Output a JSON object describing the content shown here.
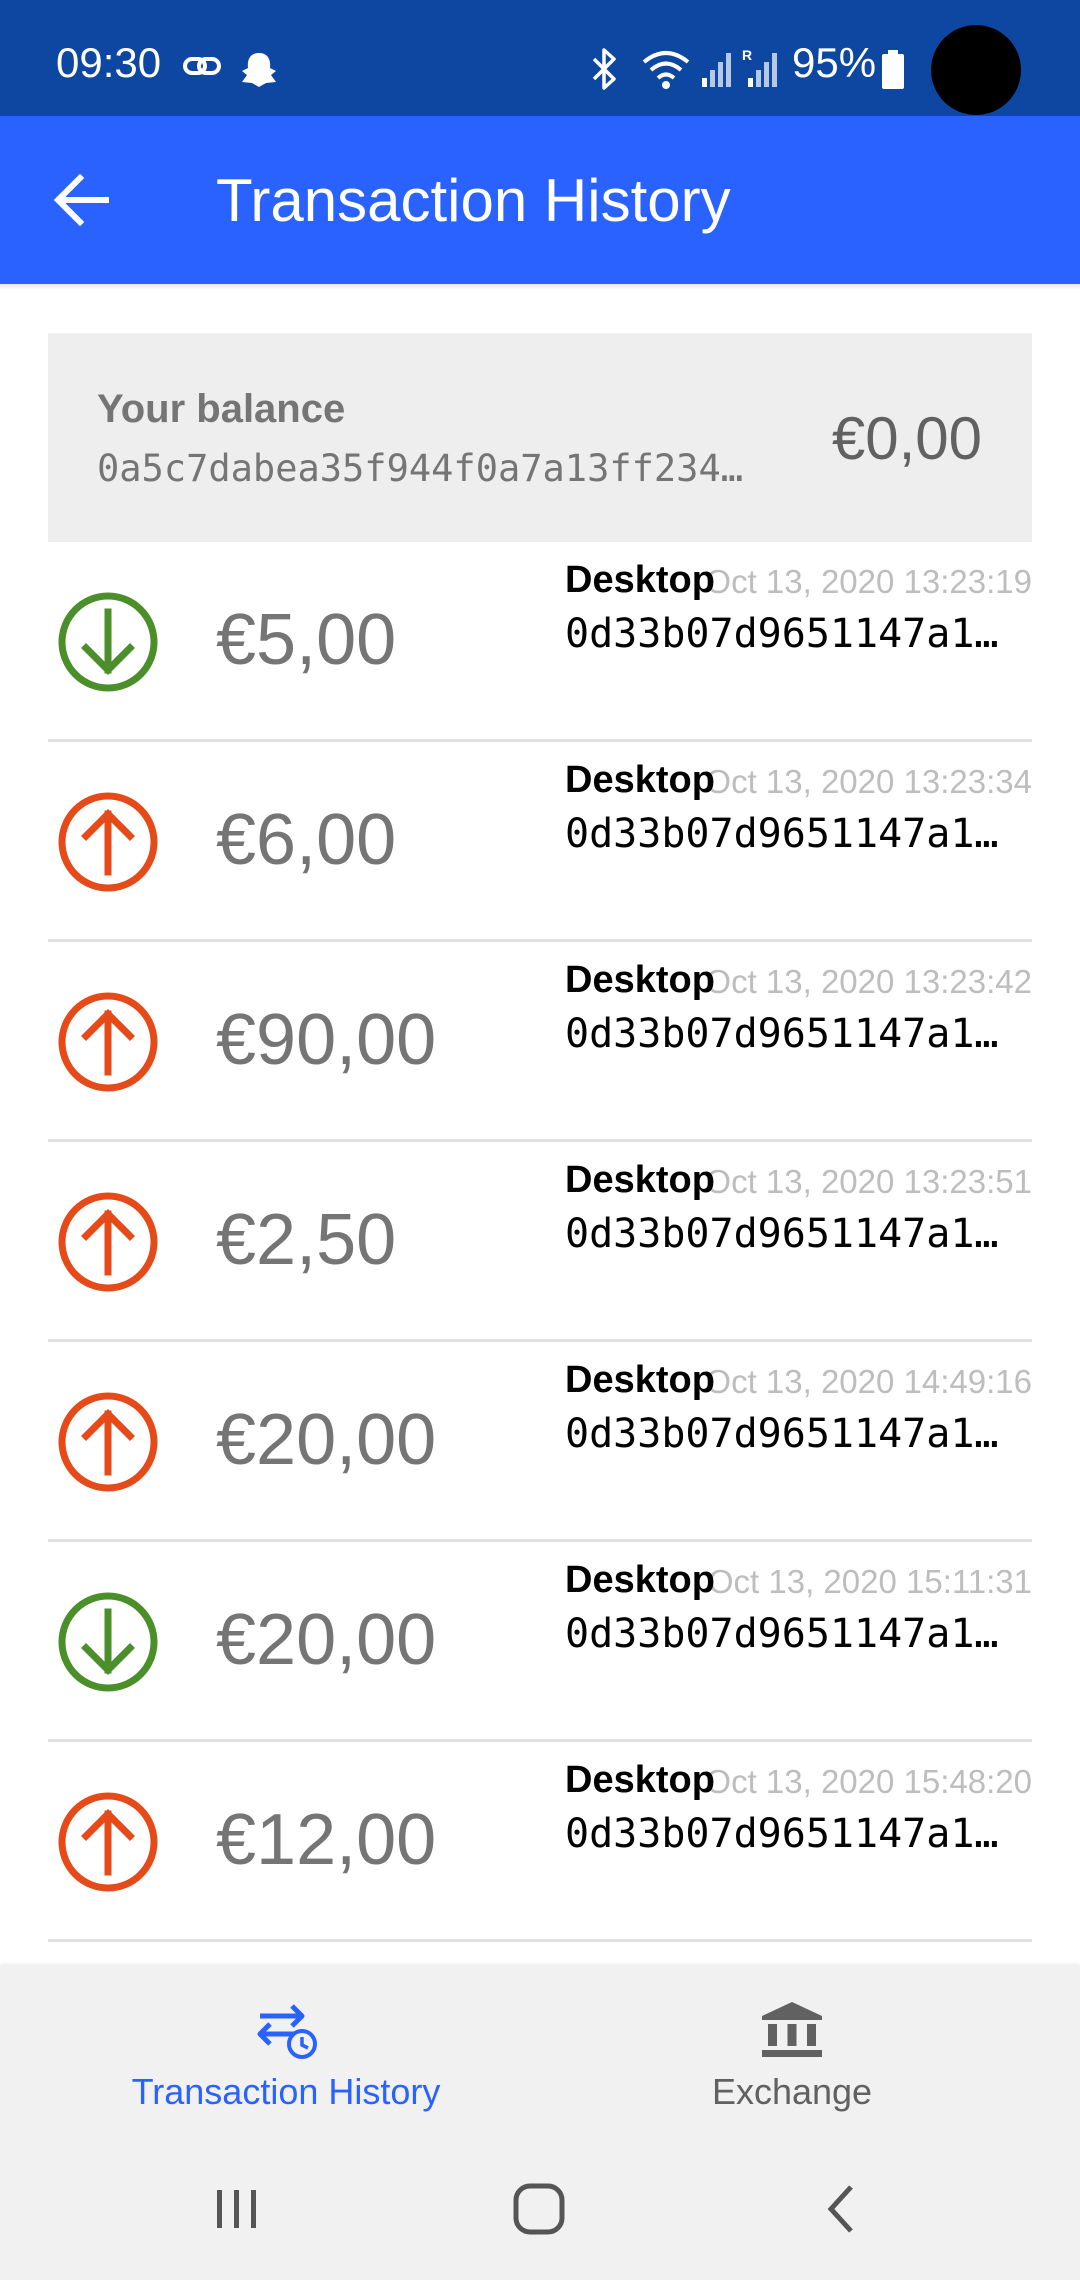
{
  "status_bar": {
    "time": "09:30",
    "battery": "95%",
    "icons": [
      "link-icon",
      "snapchat-icon",
      "bluetooth-icon",
      "wifi-icon",
      "signal-icon",
      "roaming-signal-icon",
      "battery-icon"
    ]
  },
  "header": {
    "title": "Transaction History",
    "back_icon": "arrow-back-icon"
  },
  "balance": {
    "label": "Your balance",
    "address": "0a5c7dabea35f944f0a7a13ff234…",
    "amount": "€0,00"
  },
  "transactions": [
    {
      "direction": "incoming",
      "amount": "€5,00",
      "peer": "Desktop",
      "date": "Oct 13, 2020 13:23:19",
      "address": "0d33b07d9651147a1…"
    },
    {
      "direction": "outgoing",
      "amount": "€6,00",
      "peer": "Desktop",
      "date": "Oct 13, 2020 13:23:34",
      "address": "0d33b07d9651147a1…"
    },
    {
      "direction": "outgoing",
      "amount": "€90,00",
      "peer": "Desktop",
      "date": "Oct 13, 2020 13:23:42",
      "address": "0d33b07d9651147a1…"
    },
    {
      "direction": "outgoing",
      "amount": "€2,50",
      "peer": "Desktop",
      "date": "Oct 13, 2020 13:23:51",
      "address": "0d33b07d9651147a1…"
    },
    {
      "direction": "outgoing",
      "amount": "€20,00",
      "peer": "Desktop",
      "date": "Oct 13, 2020 14:49:16",
      "address": "0d33b07d9651147a1…"
    },
    {
      "direction": "incoming",
      "amount": "€20,00",
      "peer": "Desktop",
      "date": "Oct 13, 2020 15:11:31",
      "address": "0d33b07d9651147a1…"
    },
    {
      "direction": "outgoing",
      "amount": "€12,00",
      "peer": "Desktop",
      "date": "Oct 13, 2020 15:48:20",
      "address": "0d33b07d9651147a1…"
    }
  ],
  "colors": {
    "status_bar": "#0d47a1",
    "app_bar": "#2962ff",
    "incoming": "#4a8f2a",
    "outgoing": "#e64a19",
    "active_nav": "#2962ff"
  },
  "bottom_nav": {
    "items": [
      {
        "label": "Transaction History",
        "icon": "transaction-history-icon",
        "active": true
      },
      {
        "label": "Exchange",
        "icon": "bank-icon",
        "active": false
      }
    ]
  },
  "system_nav": [
    "recent-apps-icon",
    "home-icon",
    "back-icon"
  ]
}
